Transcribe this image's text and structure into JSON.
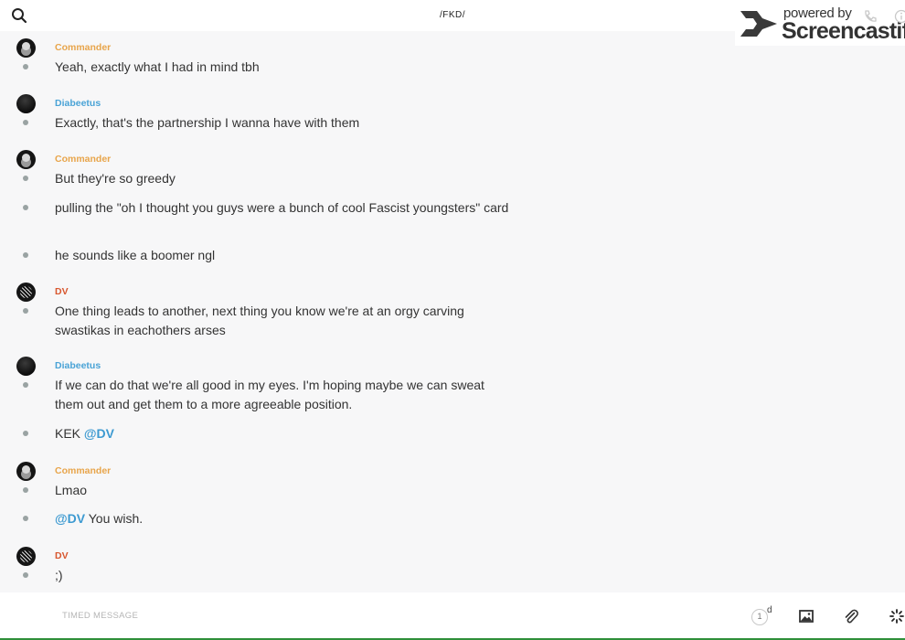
{
  "header": {
    "title": "/FKD/",
    "search_icon": "search-icon"
  },
  "watermark": {
    "line1": "powered by",
    "line2": "Screencastify"
  },
  "authors": {
    "commander": {
      "name": "Commander",
      "color": "#e8a54b"
    },
    "diabeetus": {
      "name": "Diabeetus",
      "color": "#4aa3d6"
    },
    "dv": {
      "name": "DV",
      "color": "#d8572f"
    }
  },
  "groups": [
    {
      "author": "Commander",
      "messages": [
        "Yeah, exactly what I had in mind tbh"
      ]
    },
    {
      "author": "Diabeetus",
      "messages": [
        "Exactly, that's the partnership I wanna have with them"
      ]
    },
    {
      "author": "Commander",
      "messages": [
        "But they're so greedy",
        "pulling the \"oh I thought you guys were a bunch of cool Fascist youngsters\" card",
        "he sounds like a boomer ngl"
      ]
    },
    {
      "author": "DV",
      "messages": [
        "One thing leads to another, next thing you know we're at an orgy carving swastikas in eachothers arses"
      ]
    },
    {
      "author": "Diabeetus",
      "messages": [
        "If we can do that we're all good in my eyes. I'm hoping maybe we can sweat them out and get them to a more agreeable position.",
        {
          "prefix": "KEK",
          "mention": "@DV"
        }
      ]
    },
    {
      "author": "Commander",
      "messages": [
        "Lmao",
        {
          "mention": "@DV",
          "suffix": "You wish."
        }
      ]
    },
    {
      "author": "DV",
      "messages": [
        ";)"
      ]
    }
  ],
  "composer": {
    "placeholder": "TIMED MESSAGE",
    "timer_value": "1",
    "timer_unit": "d",
    "icons": [
      "timer-icon",
      "image-icon",
      "paperclip-icon",
      "loading-icon"
    ]
  }
}
